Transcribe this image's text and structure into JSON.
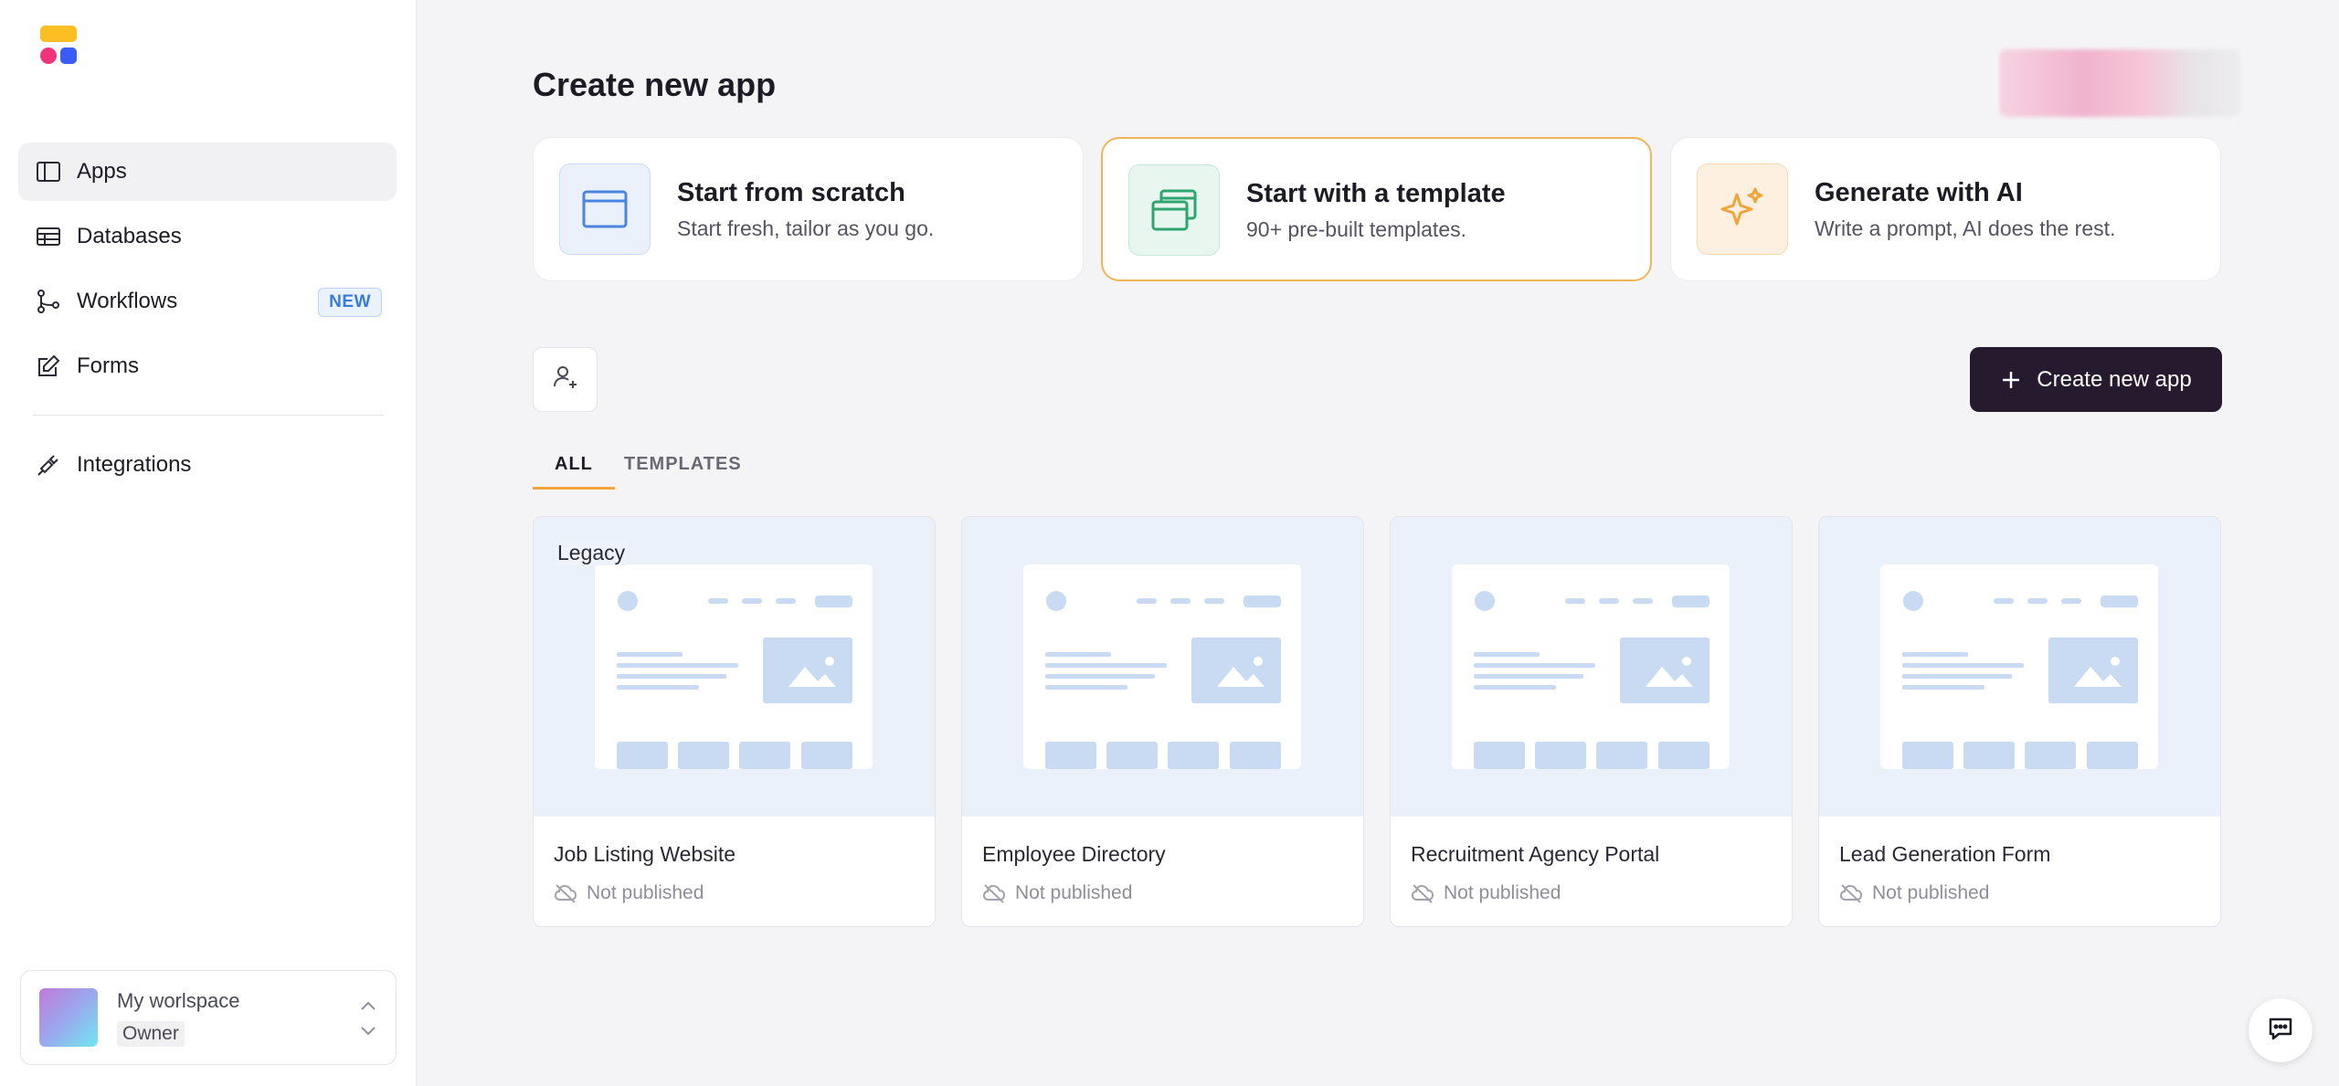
{
  "sidebar": {
    "nav": [
      {
        "label": "Apps",
        "icon": "sidebar-panel-icon",
        "active": true
      },
      {
        "label": "Databases",
        "icon": "table-icon"
      },
      {
        "label": "Workflows",
        "icon": "workflow-icon",
        "badge": "NEW"
      },
      {
        "label": "Forms",
        "icon": "edit-form-icon"
      }
    ],
    "nav2": [
      {
        "label": "Integrations",
        "icon": "plug-icon"
      }
    ],
    "workspace": {
      "name": "My worlspace",
      "role": "Owner"
    }
  },
  "main": {
    "title": "Create new app",
    "start_options": [
      {
        "title": "Start from scratch",
        "subtitle": "Start fresh, tailor as you go.",
        "icon": "window-icon"
      },
      {
        "title": "Start with a template",
        "subtitle": "90+ pre-built templates.",
        "icon": "stacked-windows-icon"
      },
      {
        "title": "Generate with AI",
        "subtitle": "Write a prompt, AI does the rest.",
        "icon": "sparkle-icon"
      }
    ],
    "create_button_label": "Create new app",
    "tabs": [
      {
        "label": "ALL",
        "active": true
      },
      {
        "label": "TEMPLATES",
        "active": false
      }
    ],
    "apps": [
      {
        "name": "Job Listing Website",
        "status": "Not published",
        "tag": "Legacy"
      },
      {
        "name": "Employee Directory",
        "status": "Not published"
      },
      {
        "name": "Recruitment Agency Portal",
        "status": "Not published"
      },
      {
        "name": "Lead Generation Form",
        "status": "Not published"
      }
    ]
  },
  "colors": {
    "accent": "#f2a33a",
    "primary_button": "#251a2e",
    "badge_blue": "#3a7bd5",
    "thumb_bg": "#eaf1fb"
  }
}
